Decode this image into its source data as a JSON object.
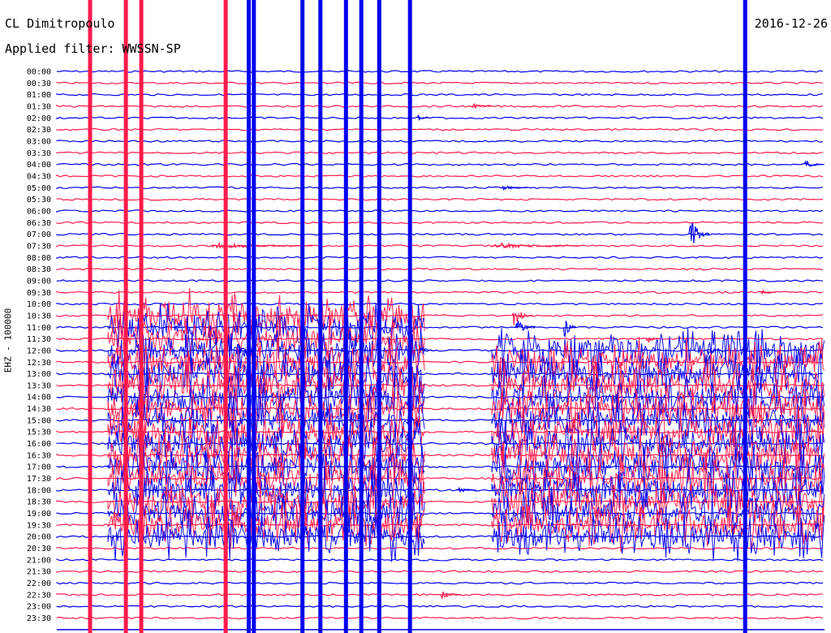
{
  "header": {
    "station": "CL Dimitropoulo",
    "filter": "Applied filter: WWSSN-SP",
    "date": "2016-12-26"
  },
  "channel_label": "EHZ - 100000",
  "colors": {
    "odd_trace": "#0000ee",
    "even_trace": "#ff1a4a",
    "background": "#ffffff",
    "text": "#000000"
  },
  "chart_data": {
    "type": "line",
    "title": "CL Dimitropoulo",
    "subtitle": "Applied filter: WWSSN-SP",
    "date": "2016-12-26",
    "ylabel": "EHZ - 100000",
    "y_tick_labels": [
      "00:00",
      "00:30",
      "01:00",
      "01:30",
      "02:00",
      "02:30",
      "03:00",
      "03:30",
      "04:00",
      "04:30",
      "05:00",
      "05:30",
      "06:00",
      "06:30",
      "07:00",
      "07:30",
      "08:00",
      "08:30",
      "09:00",
      "09:30",
      "10:00",
      "10:30",
      "11:00",
      "11:30",
      "12:00",
      "12:30",
      "13:00",
      "13:30",
      "14:00",
      "14:30",
      "15:00",
      "15:30",
      "16:00",
      "16:30",
      "17:00",
      "17:30",
      "18:00",
      "18:30",
      "19:00",
      "19:30",
      "20:00",
      "20:30",
      "21:00",
      "21:30",
      "22:00",
      "22:30",
      "23:00",
      "23:30"
    ],
    "x_unit": "minutes past row start",
    "xlim": [
      0,
      30
    ],
    "trace_colors": [
      "#0000ee",
      "#ff1a4a"
    ],
    "grid": false,
    "clipped_spikes": [
      {
        "minute": 1.3,
        "color": "red",
        "from_row": 0,
        "to_row": 47
      },
      {
        "minute": 2.7,
        "color": "red",
        "from_row": 0,
        "to_row": 47
      },
      {
        "minute": 3.3,
        "color": "red",
        "from_row": 0,
        "to_row": 47
      },
      {
        "minute": 6.6,
        "color": "red",
        "from_row": 0,
        "to_row": 47
      },
      {
        "minute": 7.5,
        "color": "blue",
        "from_row": 0,
        "to_row": 47
      },
      {
        "minute": 7.7,
        "color": "blue",
        "from_row": 0,
        "to_row": 47
      },
      {
        "minute": 9.6,
        "color": "blue",
        "from_row": 0,
        "to_row": 47
      },
      {
        "minute": 10.3,
        "color": "blue",
        "from_row": 0,
        "to_row": 47
      },
      {
        "minute": 11.3,
        "color": "blue",
        "from_row": 0,
        "to_row": 47
      },
      {
        "minute": 11.9,
        "color": "blue",
        "from_row": 0,
        "to_row": 47
      },
      {
        "minute": 12.6,
        "color": "blue",
        "from_row": 0,
        "to_row": 47
      },
      {
        "minute": 13.8,
        "color": "blue",
        "from_row": 0,
        "to_row": 47
      },
      {
        "minute": 26.9,
        "color": "blue",
        "from_row": 0,
        "to_row": 47
      }
    ],
    "events": [
      {
        "row": 3,
        "minute": 16.2,
        "amp": 6,
        "dur": 0.8
      },
      {
        "row": 4,
        "minute": 14.1,
        "amp": 5,
        "dur": 0.4
      },
      {
        "row": 8,
        "minute": 29.2,
        "amp": 7,
        "dur": 0.8
      },
      {
        "row": 10,
        "minute": 17.4,
        "amp": 4,
        "dur": 1.0
      },
      {
        "row": 14,
        "minute": 24.7,
        "amp": 26,
        "dur": 0.8
      },
      {
        "row": 15,
        "minute": 6.0,
        "amp": 5,
        "dur": 4.0
      },
      {
        "row": 15,
        "minute": 17.0,
        "amp": 5,
        "dur": 3.5
      },
      {
        "row": 19,
        "minute": 27.5,
        "amp": 4,
        "dur": 0.6
      },
      {
        "row": 21,
        "minute": 17.8,
        "amp": 16,
        "dur": 0.8
      },
      {
        "row": 22,
        "minute": 17.9,
        "amp": 14,
        "dur": 0.8
      },
      {
        "row": 22,
        "minute": 19.8,
        "amp": 18,
        "dur": 0.5
      },
      {
        "row": 23,
        "minute": 23.0,
        "amp": 10,
        "dur": 0.5
      },
      {
        "row": 24,
        "minute": 7.0,
        "amp": 14,
        "dur": 0.8
      },
      {
        "row": 24,
        "minute": 25.4,
        "amp": 10,
        "dur": 0.6
      },
      {
        "row": 24,
        "minute": 14.2,
        "amp": 8,
        "dur": 0.5
      },
      {
        "row": 36,
        "minute": 15.6,
        "amp": 5,
        "dur": 0.8
      },
      {
        "row": 45,
        "minute": 15.0,
        "amp": 6,
        "dur": 0.8
      },
      {
        "row": 48,
        "minute": 7.1,
        "amp": 12,
        "dur": 0.4
      }
    ],
    "swarm_bursts": [
      {
        "from_row": 21,
        "to_row": 40,
        "start_minute": 2.0,
        "end_minute": 14.4
      },
      {
        "from_row": 24,
        "to_row": 40,
        "start_minute": 17.0,
        "end_minute": 30.0
      }
    ]
  }
}
